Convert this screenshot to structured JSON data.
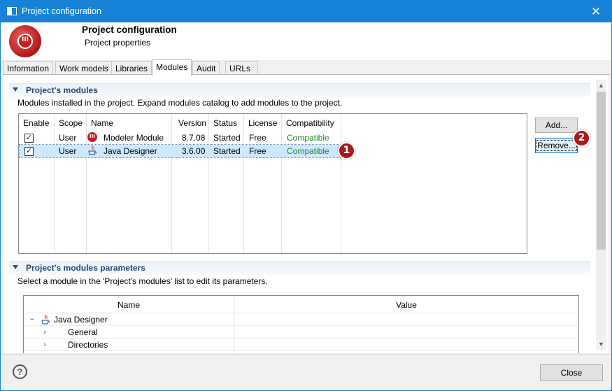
{
  "window": {
    "title": "Project configuration",
    "close_glyph": "✕"
  },
  "header": {
    "title": "Project configuration",
    "subtitle": "Project properties"
  },
  "tabs": [
    {
      "label": "Information",
      "active": false
    },
    {
      "label": "Work models",
      "active": false
    },
    {
      "label": "Libraries",
      "active": false
    },
    {
      "label": "Modules",
      "active": true
    },
    {
      "label": "Audit",
      "active": false
    },
    {
      "label": "URLs",
      "active": false
    }
  ],
  "modules_section": {
    "title": "Project's modules",
    "description": "Modules installed in the project. Expand modules catalog to add modules to the project.",
    "columns": [
      "Enable",
      "Scope",
      "Name",
      "Version",
      "Status",
      "License",
      "Compatibility"
    ],
    "rows": [
      {
        "enabled": "✓",
        "scope": "User",
        "icon": "modelio-module-icon",
        "name": "Modeler Module",
        "version": "8.7.08",
        "status": "Started",
        "license": "Free",
        "compatibility": "Compatible",
        "selected": false
      },
      {
        "enabled": "✓",
        "scope": "User",
        "icon": "java-icon",
        "name": "Java Designer",
        "version": "3.6.00",
        "status": "Started",
        "license": "Free",
        "compatibility": "Compatible",
        "selected": true
      }
    ],
    "add_label": "Add...",
    "remove_label": "Remove..."
  },
  "params_section": {
    "title": "Project's modules parameters",
    "description": "Select a module in the 'Project's modules' list to edit its parameters.",
    "columns": [
      "Name",
      "Value"
    ],
    "tree": [
      {
        "label": "Java Designer",
        "expanded": true,
        "chevron": "⌄"
      },
      {
        "label": "General",
        "chevron": "›"
      },
      {
        "label": "Directories",
        "chevron": "›"
      }
    ]
  },
  "callouts": [
    "1",
    "2"
  ],
  "footer": {
    "help_glyph": "?",
    "close_label": "Close"
  },
  "colors": {
    "titlebar": "#1883d7",
    "section_title": "#24487a",
    "compatible": "#1d8b1d",
    "callout": "#a7191b",
    "selection": "#cde8ff"
  }
}
